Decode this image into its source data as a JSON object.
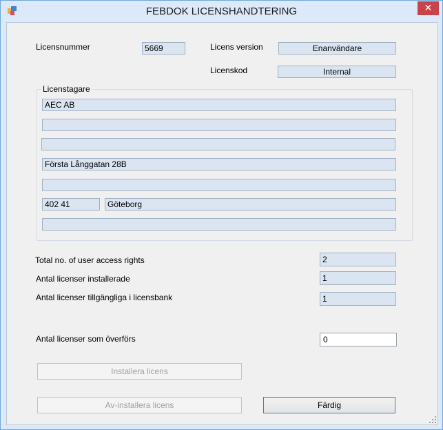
{
  "window": {
    "title": "FEBDOK LICENSHANDTERING",
    "close_glyph": "✕"
  },
  "license": {
    "number_label": "Licensnummer",
    "number_value": "5669",
    "version_label": "Licens version",
    "version_value": "Enanvändare",
    "code_label": "Licenskod",
    "code_value": "Internal"
  },
  "owner": {
    "group_label": "Licenstagare",
    "line1": "AEC AB",
    "line2": "",
    "line3": "",
    "line4": "Första Långgatan 28B",
    "line5": "",
    "postal_code": "402 41",
    "city": "Göteborg",
    "line7": ""
  },
  "stats": {
    "total_label": "Total no. of user access rights",
    "total_value": "2",
    "installed_label": "Antal licenser installerade",
    "installed_value": "1",
    "available_label": "Antal licenser tillgängliga i licensbank",
    "available_value": "1"
  },
  "transfer": {
    "label": "Antal licenser som  överförs",
    "value": "0"
  },
  "buttons": {
    "install": "Installera licens",
    "uninstall": "Av-installera licens",
    "done": "Färdig"
  },
  "icons": {
    "app": "app-icon",
    "close": "close-icon",
    "grip": "resize-grip-icon"
  },
  "colors": {
    "title_bar": "#dbe9f8",
    "readonly_field": "#dbe5f1",
    "close_button": "#c7444a",
    "primary_border": "#3c7fb1"
  }
}
